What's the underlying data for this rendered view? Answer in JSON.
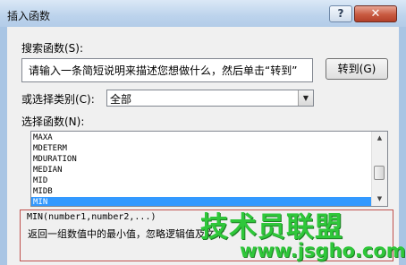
{
  "window": {
    "title": "插入函数",
    "help_label": "?",
    "close_label": "✕"
  },
  "search": {
    "label": "搜索函数(S):",
    "value": "请输入一条简短说明来描述您想做什么，然后单击“转到”",
    "goto_label": "转到(G)"
  },
  "category": {
    "label": "或选择类别(C):",
    "selected": "全部",
    "arrow_icon": "chevron-down-icon"
  },
  "functions": {
    "label": "选择函数(N):",
    "items": [
      "MAXA",
      "MDETERM",
      "MDURATION",
      "MEDIAN",
      "MID",
      "MIDB",
      "MIN"
    ],
    "selected_index": 6
  },
  "description": {
    "syntax": "MIN(number1,number2,...)",
    "text": "返回一组数值中的最小值，忽略逻辑值及文本"
  },
  "watermark": {
    "main": "技术员联盟",
    "url": "www.jsgho.com"
  },
  "colors": {
    "selection": "#3399ff",
    "watermark": "#2fc73a",
    "frame": "#c0504d"
  }
}
